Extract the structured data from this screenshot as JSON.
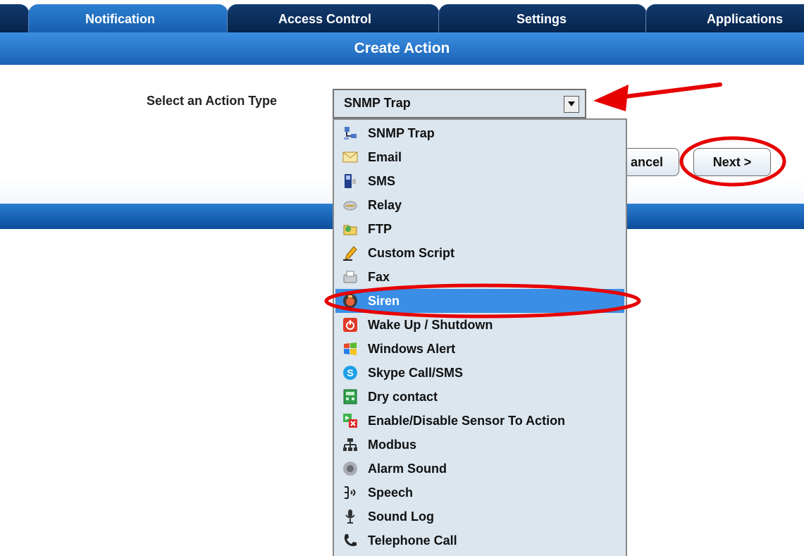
{
  "tabs": [
    {
      "label": "Notification",
      "active": true
    },
    {
      "label": "Access Control",
      "active": false
    },
    {
      "label": "Settings",
      "active": false
    },
    {
      "label": "Applications",
      "active": false
    }
  ],
  "title": "Create Action",
  "form": {
    "action_type_label": "Select an Action Type",
    "selected_value": "SNMP Trap"
  },
  "buttons": {
    "cancel_label": "ancel",
    "next_label": "Next >"
  },
  "dropdown_options": [
    {
      "label": "SNMP Trap",
      "icon": "network-icon"
    },
    {
      "label": "Email",
      "icon": "envelope-icon"
    },
    {
      "label": "SMS",
      "icon": "phone-icon"
    },
    {
      "label": "Relay",
      "icon": "relay-icon"
    },
    {
      "label": "FTP",
      "icon": "ftp-icon"
    },
    {
      "label": "Custom Script",
      "icon": "pencil-icon"
    },
    {
      "label": "Fax",
      "icon": "fax-icon"
    },
    {
      "label": "Siren",
      "icon": "siren-icon",
      "selected": true
    },
    {
      "label": "Wake Up / Shutdown",
      "icon": "power-icon"
    },
    {
      "label": "Windows Alert",
      "icon": "windows-icon"
    },
    {
      "label": "Skype Call/SMS",
      "icon": "skype-icon"
    },
    {
      "label": "Dry contact",
      "icon": "dry-contact-icon"
    },
    {
      "label": "Enable/Disable Sensor To Action",
      "icon": "toggle-sensor-icon"
    },
    {
      "label": "Modbus",
      "icon": "modbus-icon"
    },
    {
      "label": "Alarm Sound",
      "icon": "speaker-icon"
    },
    {
      "label": "Speech",
      "icon": "speech-icon"
    },
    {
      "label": "Sound Log",
      "icon": "microphone-icon"
    },
    {
      "label": "Telephone Call",
      "icon": "telephone-icon"
    }
  ],
  "colors": {
    "tab_dark": "#06244c",
    "tab_active": "#2c7fd0",
    "title_bar": "#2a7dd0",
    "selection": "#3a8ee6",
    "annotation": "#e60000"
  }
}
